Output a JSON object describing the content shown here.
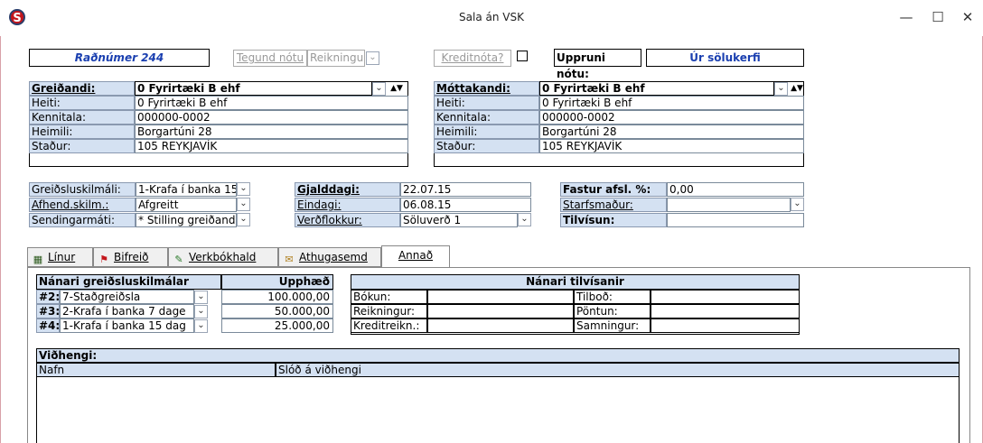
{
  "window": {
    "title": "Sala án VSK",
    "minimize": "—",
    "maximize": "☐",
    "close": "✕"
  },
  "header": {
    "radnumer": "Raðnúmer 244",
    "tegund_label": "Tegund nótu",
    "tegund_value": "Reikningu",
    "kreditnota_label": "Kreditnóta?",
    "uppruni_label": "Uppruni nótu:",
    "uppruni_value": "Úr sölukerfi"
  },
  "payer": {
    "title": "Greiðandi:",
    "value": "0 Fyrirtæki B ehf",
    "rows": [
      {
        "label": "Heiti:",
        "value": "0 Fyrirtæki B ehf"
      },
      {
        "label": "Kennitala:",
        "value": "000000-0002"
      },
      {
        "label": "Heimili:",
        "value": "Borgartúni 28"
      },
      {
        "label": "Staður:",
        "value": "105 REYKJAVÍK"
      }
    ]
  },
  "receiver": {
    "title": "Móttakandi:",
    "value": "0 Fyrirtæki B ehf",
    "rows": [
      {
        "label": "Heiti:",
        "value": "0 Fyrirtæki B ehf"
      },
      {
        "label": "Kennitala:",
        "value": "000000-0002"
      },
      {
        "label": "Heimili:",
        "value": "Borgartúni 28"
      },
      {
        "label": "Staður:",
        "value": "105 REYKJAVÍK"
      }
    ]
  },
  "terms": {
    "greidsluskilmali_label": "Greiðsluskilmáli:",
    "greidsluskilmali_value": "1-Krafa í banka 15 d",
    "afhend_label": "Afhend.skilm.:",
    "afhend_value": "Afgreitt",
    "sending_label": "Sendingarmáti:",
    "sending_value": "* Stilling greiðanda",
    "gjalddagi_label": "Gjalddagi:",
    "gjalddagi_value": "22.07.15",
    "eindagi_label": "Eindagi:",
    "eindagi_value": "06.08.15",
    "verdflokkur_label": "Verðflokkur:",
    "verdflokkur_value": "Söluverð 1",
    "fastur_label": "Fastur afsl. %:",
    "fastur_value": "0,00",
    "starfsmadur_label": "Starfsmaður:",
    "starfsmadur_value": "",
    "tilvisun_label": "Tilvísun:",
    "tilvisun_value": ""
  },
  "tabs": [
    {
      "label": "Línur",
      "icon": "lines-icon"
    },
    {
      "label": "Bifreið",
      "icon": "flag-icon"
    },
    {
      "label": "Verkbókhald",
      "icon": "chart-icon"
    },
    {
      "label": "Athugasemd",
      "icon": "note-icon"
    },
    {
      "label": "Annað",
      "icon": ""
    }
  ],
  "payment_terms": {
    "header": "Nánari greiðsluskilmálar",
    "amount_header": "Upphæð",
    "rows": [
      {
        "num": "#2:",
        "value": "7-Staðgreiðsla",
        "amount": "100.000,00"
      },
      {
        "num": "#3:",
        "value": "2-Krafa í banka 7 dage",
        "amount": "50.000,00"
      },
      {
        "num": "#4:",
        "value": "1-Krafa í banka 15 dag",
        "amount": "25.000,00"
      }
    ]
  },
  "references": {
    "header": "Nánari tilvísanir",
    "left": [
      {
        "label": "Bókun:",
        "value": ""
      },
      {
        "label": "Reikningur:",
        "value": ""
      },
      {
        "label": "Kreditreikn.:",
        "value": ""
      }
    ],
    "right": [
      {
        "label": "Tilboð:",
        "value": ""
      },
      {
        "label": "Pöntun:",
        "value": ""
      },
      {
        "label": "Samningur:",
        "value": ""
      }
    ]
  },
  "attachments": {
    "title": "Viðhengi:",
    "col_name": "Nafn",
    "col_link": "Slóð á viðhengi"
  }
}
